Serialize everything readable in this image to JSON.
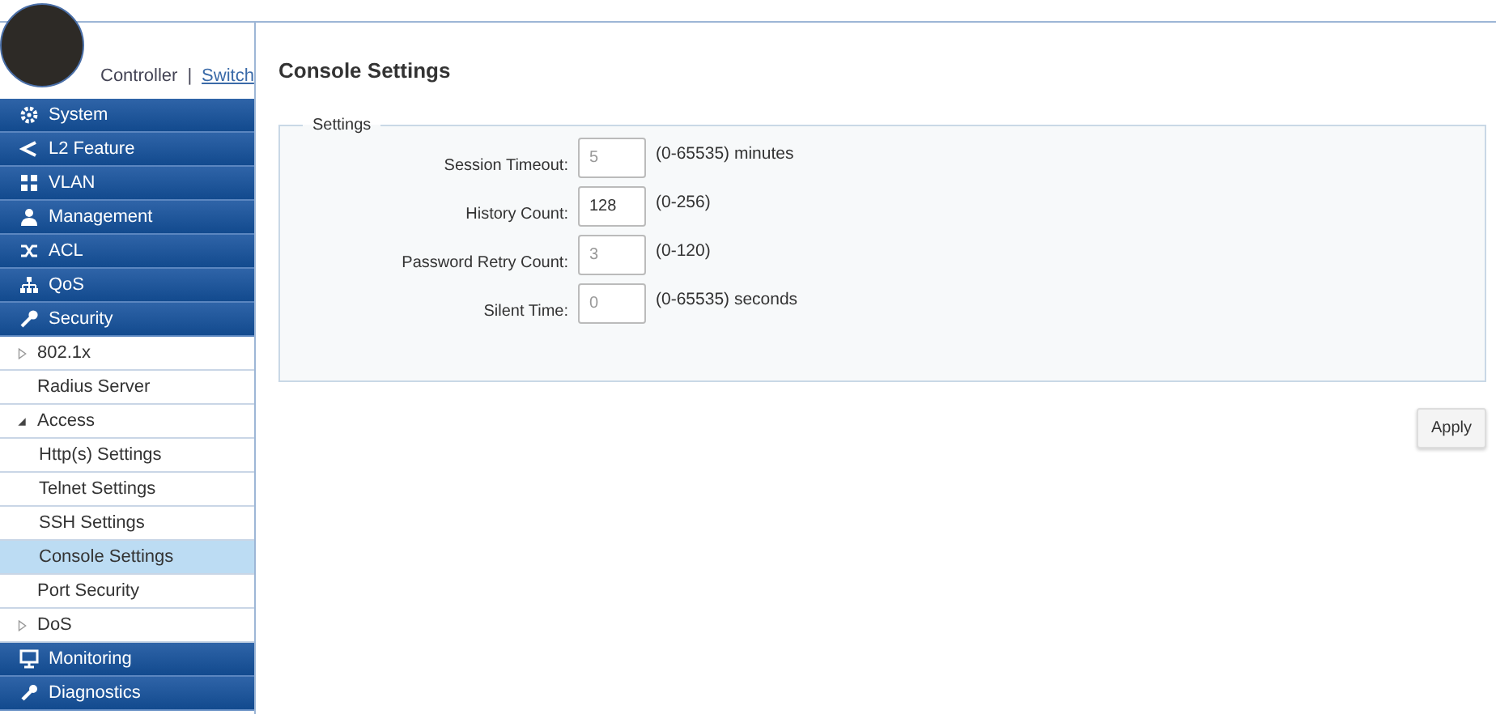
{
  "header": {
    "mode_links": [
      {
        "label": "Controller",
        "selected": false
      },
      {
        "label": "Switch",
        "selected": true
      }
    ],
    "separator": "|"
  },
  "sidebar": {
    "items": [
      {
        "kind": "section",
        "label": "System",
        "selected": false
      },
      {
        "kind": "section",
        "label": "L2 Feature",
        "selected": false
      },
      {
        "kind": "section",
        "label": "VLAN",
        "selected": false
      },
      {
        "kind": "section",
        "label": "Management",
        "selected": false
      },
      {
        "kind": "section",
        "label": "ACL",
        "selected": false
      },
      {
        "kind": "section",
        "label": "QoS",
        "selected": false
      },
      {
        "kind": "section",
        "label": "Security",
        "selected": false,
        "children": [
          {
            "label": "802.1x",
            "selected": false,
            "expanded": false
          },
          {
            "label": "Radius Server",
            "selected": false
          },
          {
            "label": "Access",
            "selected": false,
            "expanded": true,
            "children": [
              {
                "label": "Http(s) Settings",
                "selected": false
              },
              {
                "label": "Telnet Settings",
                "selected": false
              },
              {
                "label": "SSH Settings",
                "selected": false
              },
              {
                "label": "Console Settings",
                "selected": true
              }
            ]
          },
          {
            "label": "Port Security",
            "selected": false
          },
          {
            "label": "DoS",
            "selected": false,
            "expanded": false
          }
        ]
      },
      {
        "kind": "section",
        "label": "Monitoring",
        "selected": false
      },
      {
        "kind": "section",
        "label": "Diagnostics",
        "selected": false
      }
    ]
  },
  "page": {
    "title": "Console Settings",
    "fieldset": {
      "legend": "Settings",
      "fields": [
        {
          "label": "Session Timeout:",
          "placeholder": "5",
          "range": "(0-65535) minutes"
        },
        {
          "label": "History Count:",
          "value": "128",
          "range": "(0-256)"
        },
        {
          "label": "Password Retry Count:",
          "placeholder": "3",
          "range": "(0-120)"
        },
        {
          "label": "Silent Time:",
          "placeholder": "0",
          "range": "(0-65535) seconds"
        }
      ]
    },
    "buttons": [
      "Apply"
    ]
  }
}
